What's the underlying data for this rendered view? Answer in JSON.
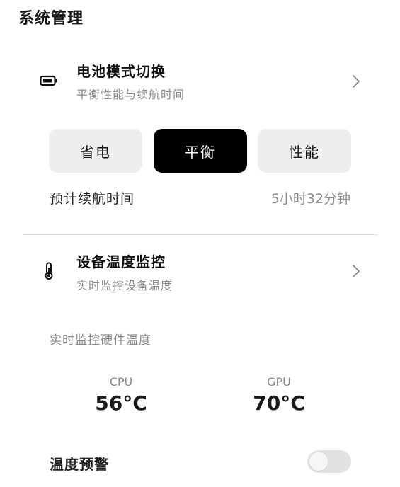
{
  "header": {
    "title": "系统管理"
  },
  "battery": {
    "icon": "battery-icon",
    "title": "电池模式切换",
    "subtitle": "平衡性能与续航时间",
    "modes": [
      {
        "label": "省电",
        "selected": false
      },
      {
        "label": "平衡",
        "selected": true
      },
      {
        "label": "性能",
        "selected": false
      }
    ],
    "estimate_label": "预计续航时间",
    "estimate_value": "5小时32分钟"
  },
  "temperature": {
    "icon": "thermometer-icon",
    "title": "设备温度监控",
    "subtitle": "实时监控设备温度",
    "hardware_label": "实时监控硬件温度",
    "stats": [
      {
        "name": "CPU",
        "value": "56°C"
      },
      {
        "name": "GPU",
        "value": "70°C"
      }
    ],
    "alert_label": "温度预警",
    "alert_enabled": false
  },
  "colors": {
    "selected_bg": "#000000",
    "unselected_bg": "#eeeeee",
    "muted_text": "#8a8a8a"
  }
}
